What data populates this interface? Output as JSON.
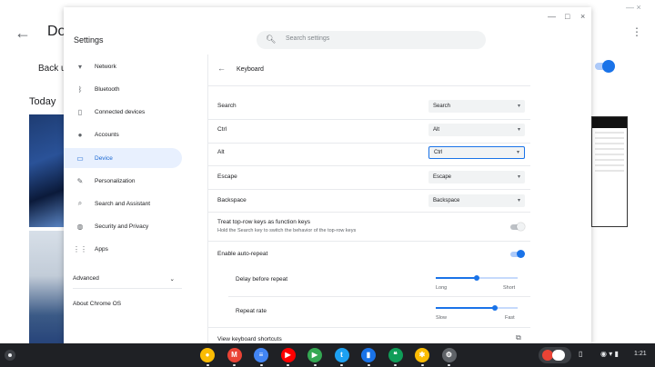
{
  "background_app": {
    "back_glyph": "←",
    "title": "Do",
    "subtitle": "Back u",
    "section": "Today",
    "menu_glyph": "⋮",
    "window_controls": "— ×"
  },
  "settings": {
    "title": "Settings",
    "search_placeholder": "Search settings",
    "window_buttons": {
      "minimize": "—",
      "maximize": "□",
      "close": "×"
    },
    "nav": {
      "items": [
        {
          "label": "Network",
          "icon": "wifi-icon",
          "glyph": "▾"
        },
        {
          "label": "Bluetooth",
          "icon": "bluetooth-icon",
          "glyph": "ᛒ"
        },
        {
          "label": "Connected devices",
          "icon": "phone-icon",
          "glyph": "▯"
        },
        {
          "label": "Accounts",
          "icon": "person-icon",
          "glyph": "●"
        },
        {
          "label": "Device",
          "icon": "laptop-icon",
          "glyph": "▭"
        },
        {
          "label": "Personalization",
          "icon": "pencil-icon",
          "glyph": "✎"
        },
        {
          "label": "Search and Assistant",
          "icon": "search-icon",
          "glyph": "⌕"
        },
        {
          "label": "Security and Privacy",
          "icon": "globe-icon",
          "glyph": "◍"
        },
        {
          "label": "Apps",
          "icon": "apps-grid-icon",
          "glyph": "⋮⋮"
        }
      ],
      "advanced": "Advanced",
      "advanced_caret": "⌄",
      "about": "About Chrome OS"
    },
    "keyboard": {
      "back_glyph": "←",
      "title": "Keyboard",
      "remaps": [
        {
          "label": "Search",
          "value": "Search"
        },
        {
          "label": "Ctrl",
          "value": "Alt"
        },
        {
          "label": "Alt",
          "value": "Ctrl"
        },
        {
          "label": "Escape",
          "value": "Escape"
        },
        {
          "label": "Backspace",
          "value": "Backspace"
        }
      ],
      "caret": "▾",
      "function_keys": {
        "label": "Treat top-row keys as function keys",
        "description": "Hold the Search key to switch the behavior of the top-row keys",
        "enabled": false
      },
      "auto_repeat": {
        "label": "Enable auto-repeat",
        "enabled": true
      },
      "delay": {
        "label": "Delay before repeat",
        "min": "Long",
        "max": "Short",
        "value_fraction": 0.5
      },
      "rate": {
        "label": "Repeat rate",
        "min": "Slow",
        "max": "Fast",
        "value_fraction": 0.72
      },
      "shortcuts": {
        "label": "View keyboard shortcuts",
        "icon": "open-in-new-icon",
        "glyph": "⧉"
      }
    }
  },
  "shelf": {
    "apps": [
      {
        "name": "chrome-icon",
        "color": "#fbbc04",
        "glyph": "●"
      },
      {
        "name": "gmail-icon",
        "color": "#ea4335",
        "glyph": "M"
      },
      {
        "name": "docs-icon",
        "color": "#4285f4",
        "glyph": "≡"
      },
      {
        "name": "youtube-icon",
        "color": "#ff0000",
        "glyph": "▶"
      },
      {
        "name": "play-store-icon",
        "color": "#34a853",
        "glyph": "▶"
      },
      {
        "name": "twitter-icon",
        "color": "#1da1f2",
        "glyph": "t"
      },
      {
        "name": "files-icon",
        "color": "#1a73e8",
        "glyph": "▮"
      },
      {
        "name": "hangouts-icon",
        "color": "#0f9d58",
        "glyph": "❝"
      },
      {
        "name": "photos-icon",
        "color": "#fbbc04",
        "glyph": "✱"
      },
      {
        "name": "settings-icon",
        "color": "#5f6368",
        "glyph": "⚙"
      }
    ],
    "tray": {
      "phone_glyph": "▯",
      "status_glyphs": "◉ ▾ ▮",
      "time": "1:21"
    }
  }
}
